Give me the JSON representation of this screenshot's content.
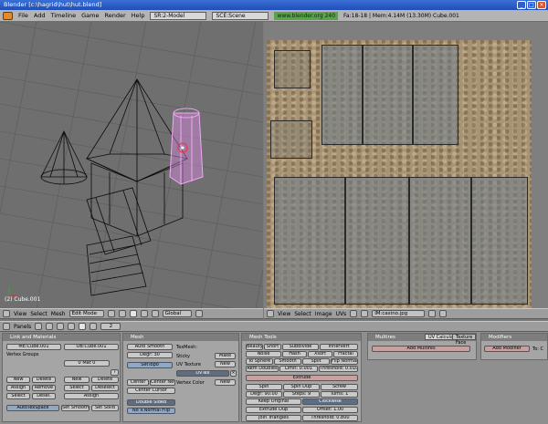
{
  "window": {
    "title": "Blender [c:\\hagrid\\hut\\hut.blend]"
  },
  "info_header": {
    "menus": [
      "File",
      "Add",
      "Timeline",
      "Game",
      "Render",
      "Help"
    ],
    "screen": "SR:2-Model",
    "scene": "SCE:Scene",
    "website": "www.blender.org 240",
    "stats": "Fa:18-18 | Mem:4.14M (13.30M) Cube.001"
  },
  "viewport3d": {
    "object_label": "(2) Cube.001",
    "header": {
      "menus": [
        "View",
        "Select",
        "Mesh"
      ],
      "mode": "Edit Mode",
      "orientation": "Global"
    }
  },
  "uv_editor": {
    "header": {
      "menus": [
        "View",
        "Select",
        "Image",
        "UVs"
      ],
      "image_name": "IM:casino.jpg"
    }
  },
  "buttons_window": {
    "panels_label": "Panels",
    "frame": "2",
    "link_materials": {
      "title": "Link and Materials",
      "me": "ME:Cube.001",
      "ob": "OB:Cube.001",
      "vertex_groups": "Vertex Groups",
      "mat_label": "0 Mat 0",
      "mat_question": "?",
      "left_buttons": [
        "New",
        "Delete",
        "Assign",
        "Remove",
        "Select",
        "Desel."
      ],
      "right_buttons": [
        "New",
        "Delete",
        "Select",
        "Deselect",
        "Assign"
      ],
      "set_smooth": "Set Smooth",
      "set_solid": "Set Solid",
      "autotexspace": "AutoTexSpace"
    },
    "mesh": {
      "title": "Mesh",
      "auto_smooth": "Auto Smooth",
      "degr": "Degr: 30",
      "sticky": "Sticky",
      "uv_texture": "UV Texture",
      "vertex_color": "Vertex Color",
      "texmesh": "TexMesh:",
      "make": "Make",
      "new": "New",
      "new2": "New",
      "setopo": "SetTopo",
      "uvtex": "UVTex",
      "center": "Center",
      "center_new": "Center New",
      "center_cursor": "Center Cursor",
      "double_sided": "Double Sided",
      "no_v_normal_flip": "No V.Normal Flip"
    },
    "mesh_tools": {
      "title": "Mesh Tools",
      "row1": [
        "Beauty",
        "Short",
        "Subdivide",
        "Innervert"
      ],
      "row2": [
        "Noise",
        "Hash",
        "Xsort",
        "Fractal"
      ],
      "row3": [
        "To Sphere",
        "Smooth",
        "Split",
        "Flip Normals"
      ],
      "rem_doubles": "Rem Doubles",
      "limit": "Limit: 0.001",
      "threshold": "Threshold: 0.010",
      "extrude": "Extrude",
      "spin": "Spin",
      "spin_dup": "Spin Dup",
      "screw": "Screw",
      "degr": "Degr: 90.00",
      "steps": "Steps: 9",
      "turns": "Turns: 1",
      "keep_original": "Keep Original",
      "clockwise": "Clockwise",
      "extrude_dup": "Extrude Dup",
      "offset": "Offset: 1.00",
      "join_triangles": "Join Triangles",
      "threshold2": "Threshold: 0.800"
    },
    "multires": {
      "title": "Multires",
      "tabs": [
        "UV Calculation",
        "Texture Face"
      ],
      "add_multires": "Add Multires"
    },
    "modifiers": {
      "title": "Modifiers",
      "add_modifier": "Add Modifier",
      "to": "To: C"
    }
  }
}
